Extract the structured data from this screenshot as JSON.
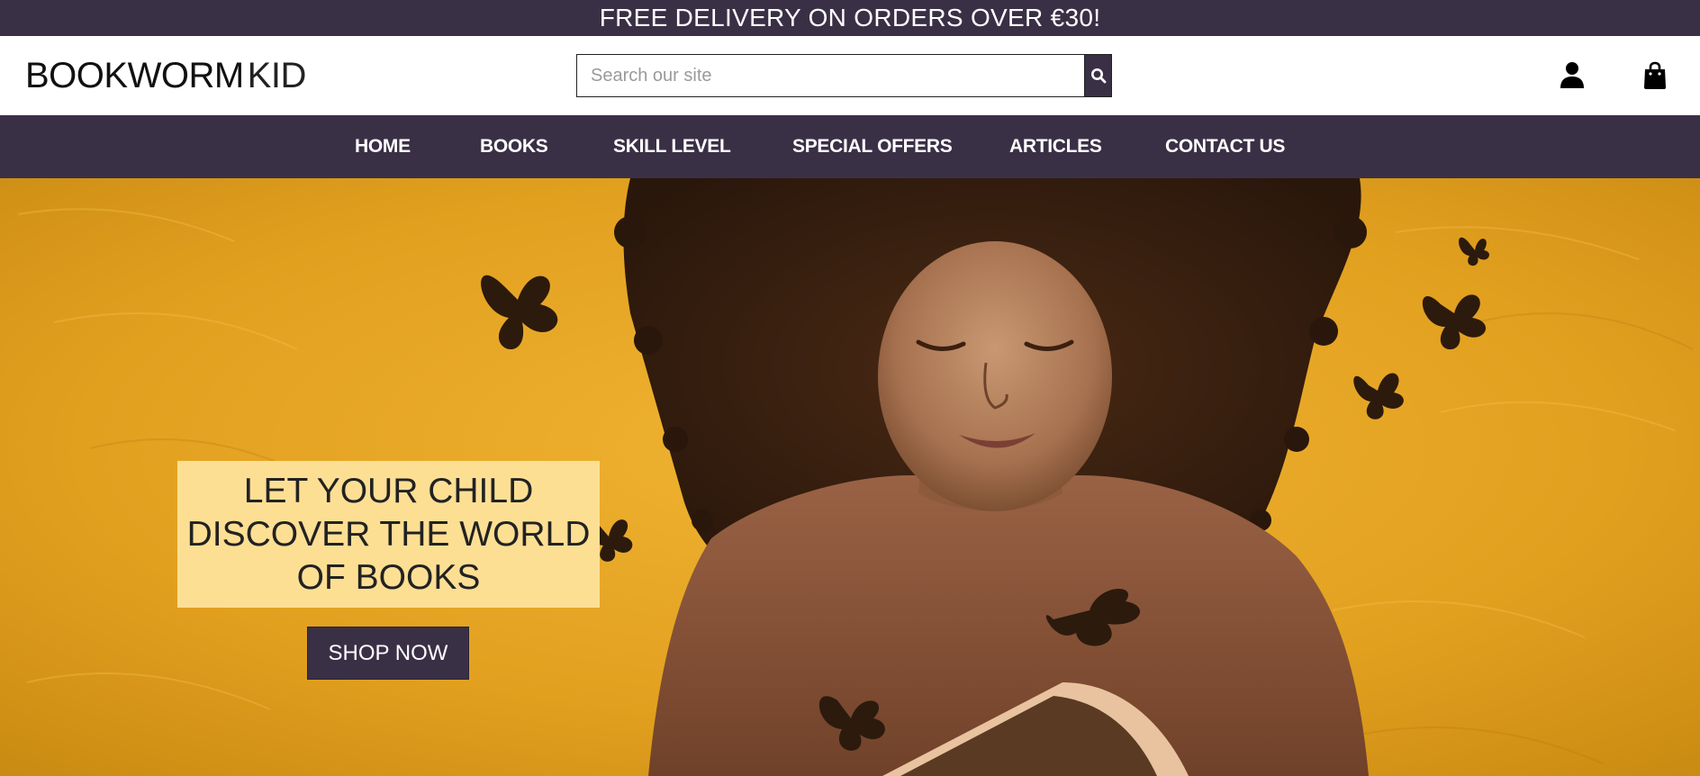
{
  "promo": {
    "text": "FREE DELIVERY ON ORDERS OVER €30!"
  },
  "header": {
    "logo_bold": "BOOKWORM",
    "logo_light": "KID",
    "search": {
      "placeholder": "Search our site",
      "value": ""
    },
    "icons": {
      "search": "search-icon",
      "account": "user-icon",
      "cart": "shopping-bag-icon"
    }
  },
  "nav": {
    "items": [
      {
        "label": "HOME"
      },
      {
        "label": "BOOKS"
      },
      {
        "label": "SKILL LEVEL"
      },
      {
        "label": "SPECIAL OFFERS"
      },
      {
        "label": "ARTICLES"
      },
      {
        "label": "CONTACT US"
      }
    ]
  },
  "hero": {
    "tagline": "LET YOUR CHILD DISCOVER THE WORLD OF BOOKS",
    "cta_label": "SHOP NOW"
  },
  "colors": {
    "brand_dark": "#3a3046",
    "hero_gold": "#e4a21e",
    "tagline_bg": "#fddf94"
  }
}
